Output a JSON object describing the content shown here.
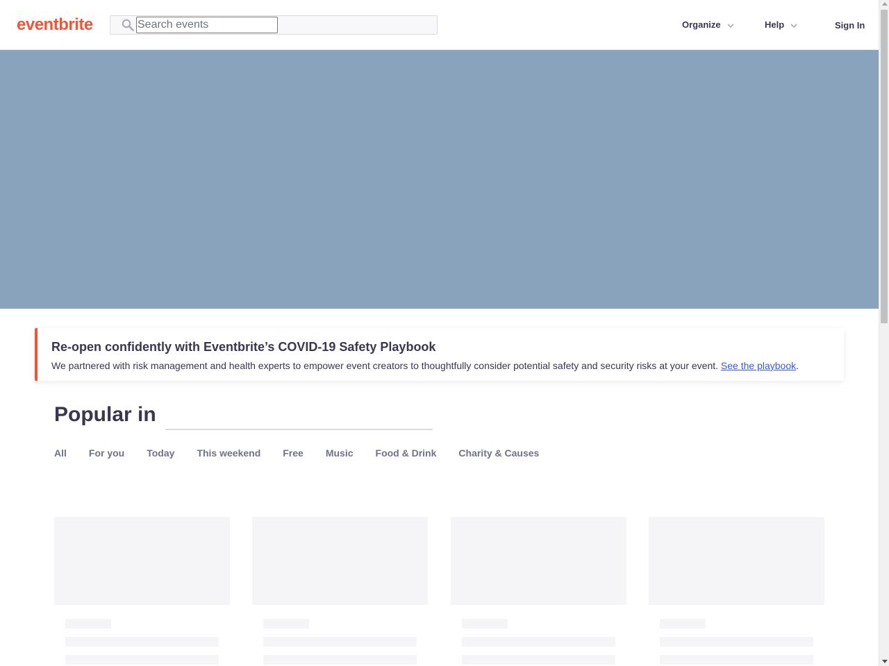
{
  "header": {
    "logo_text": "eventbrite",
    "search_placeholder": "Search events",
    "nav": {
      "organize": "Organize",
      "help": "Help",
      "sign_in": "Sign In"
    }
  },
  "notice": {
    "title": "Re-open confidently with Eventbrite’s COVID-19 Safety Playbook",
    "text": "We partnered with risk management and health experts to empower event creators to thoughtfully consider potential safety and security risks at your event. ",
    "link": "See the playbook",
    "trail": "."
  },
  "popular": {
    "title": "Popular in",
    "tabs": [
      "All",
      "For you",
      "Today",
      "This weekend",
      "Free",
      "Music",
      "Food & Drink",
      "Charity & Causes"
    ]
  },
  "colors": {
    "brand": "#f05537",
    "hero": "#89a3bd",
    "link": "#3659e3"
  }
}
